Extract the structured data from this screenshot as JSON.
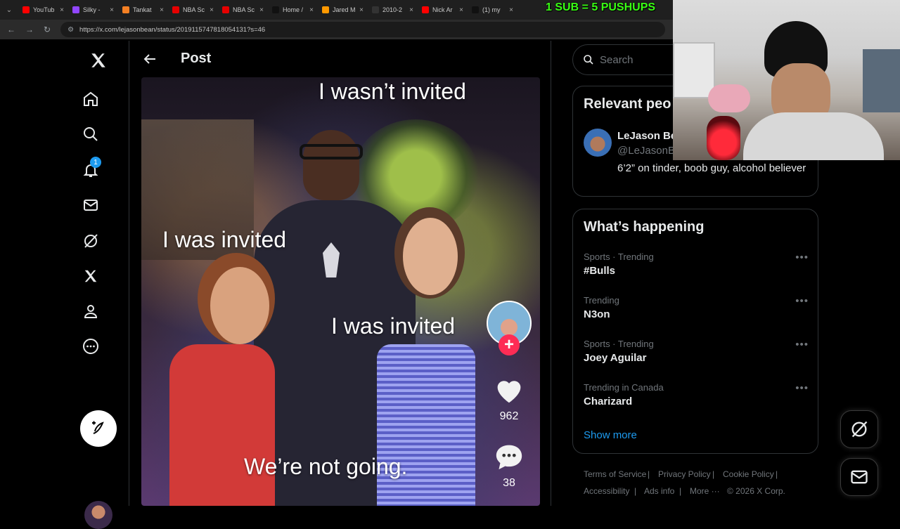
{
  "browser": {
    "tabs": [
      {
        "label": "YouTub",
        "color": "#ff0000"
      },
      {
        "label": "Silky -",
        "color": "#9146ff"
      },
      {
        "label": "Tankat",
        "color": "#f48024"
      },
      {
        "label": "NBA Sc",
        "color": "#e60000"
      },
      {
        "label": "NBA Sc",
        "color": "#e60000"
      },
      {
        "label": "Home /",
        "color": "#111111"
      },
      {
        "label": "Jared M",
        "color": "#ff9900"
      },
      {
        "label": "2010-2",
        "color": "#333333"
      },
      {
        "label": "Nick Ar",
        "color": "#ff0000"
      },
      {
        "label": "(1) my",
        "color": "#111111"
      }
    ],
    "url": "https://x.com/lejasonbean/status/2019115747818054131?s=46"
  },
  "stream": {
    "banner": "1 SUB = 5 PUSHUPS"
  },
  "nav": {
    "notifications_badge": "1"
  },
  "header": {
    "title": "Post"
  },
  "media": {
    "captions": {
      "top": "I wasn’t invited",
      "left": "I was invited",
      "right": "I was invited",
      "bottom": "We’re not going."
    },
    "likes": "962",
    "comments": "38"
  },
  "search": {
    "placeholder": "Search"
  },
  "relevant": {
    "title": "Relevant peo",
    "name": "LeJason Be",
    "handle": "@LeJasonB",
    "bio": "6’2” on tinder, boob guy, alcohol believer"
  },
  "happening": {
    "title": "What’s happening",
    "trends": [
      {
        "meta": "Sports · Trending",
        "name": "#Bulls"
      },
      {
        "meta": "Trending",
        "name": "N3on"
      },
      {
        "meta": "Sports · Trending",
        "name": "Joey Aguilar"
      },
      {
        "meta": "Trending in Canada",
        "name": "Charizard"
      }
    ],
    "show_more": "Show more"
  },
  "footer": {
    "terms": "Terms of Service",
    "privacy": "Privacy Policy",
    "cookie": "Cookie Policy",
    "accessibility": "Accessibility",
    "ads": "Ads info",
    "more": "More ···",
    "copyright": "© 2026 X Corp."
  }
}
